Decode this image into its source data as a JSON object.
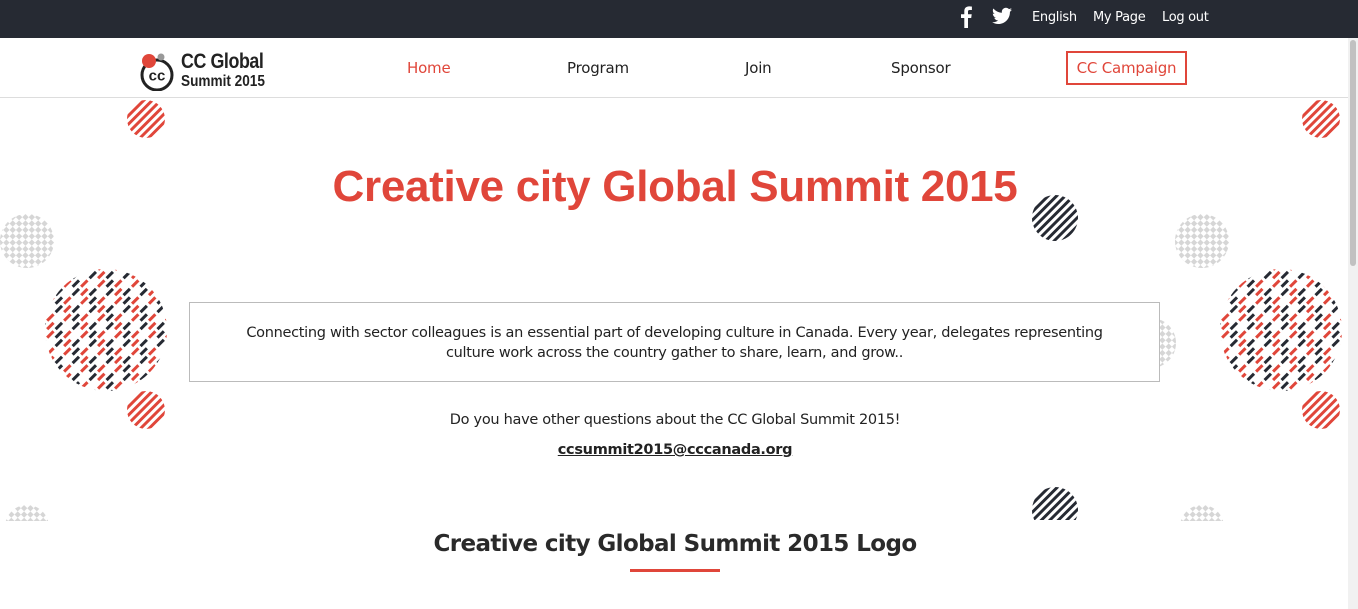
{
  "topbar": {
    "facebook_icon": "facebook-icon",
    "twitter_icon": "twitter-icon",
    "language": "English",
    "my_page": "My Page",
    "logout": "Log out"
  },
  "logo": {
    "line1": "CC Global",
    "line2": "Summit 2015",
    "mark_text": "cc"
  },
  "nav": {
    "items": [
      {
        "label": "Home",
        "active": true
      },
      {
        "label": "Program",
        "active": false
      },
      {
        "label": "Join",
        "active": false
      },
      {
        "label": "Sponsor",
        "active": false
      }
    ],
    "cta": "CC Campaign"
  },
  "hero": {
    "title": "Creative city Global Summit 2015",
    "intro": "Connecting with sector colleagues is an essential part of developing culture in Canada. Every year, delegates representing culture work across the country gather to share, learn, and grow..",
    "question": "Do you have other questions about the CC Global Summit 2015!",
    "email": "ccsummit2015@cccanada.org"
  },
  "section": {
    "title": "Creative city Global Summit 2015 Logo"
  },
  "colors": {
    "accent": "#e0463a",
    "dark": "#262a33",
    "pattern_gray": "#d6d6d6"
  }
}
